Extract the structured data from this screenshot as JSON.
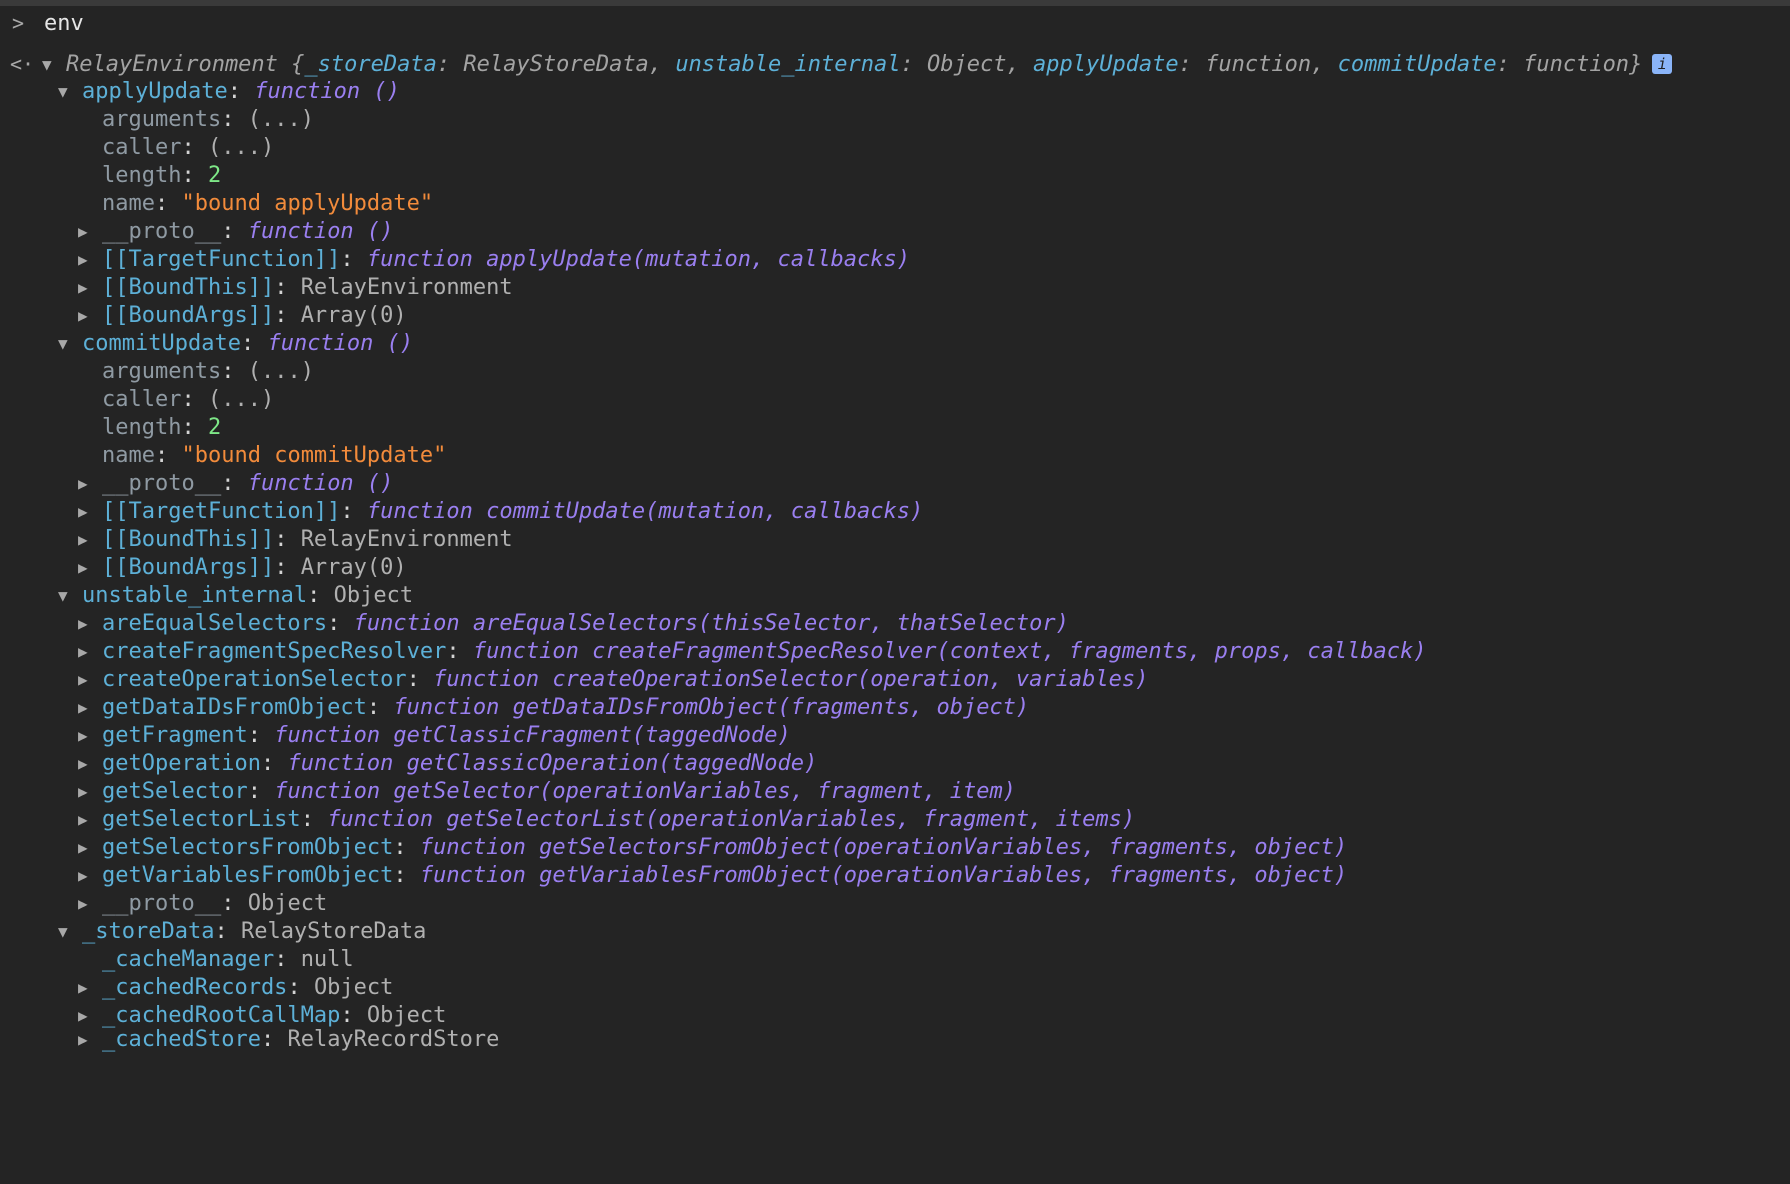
{
  "console": {
    "input": {
      "prompt": ">",
      "command": "env"
    },
    "result": {
      "back_arrow": "<·",
      "class_name": "RelayEnvironment",
      "preview": [
        {
          "key": "_storeData",
          "value": "RelayStoreData"
        },
        {
          "key": "unstable_internal",
          "value": "Object"
        },
        {
          "key": "applyUpdate",
          "value": "function"
        },
        {
          "key": "commitUpdate",
          "value": "function"
        }
      ],
      "info_badge": "i"
    }
  },
  "tree": {
    "applyUpdate": {
      "key": "applyUpdate",
      "value": "function ()",
      "children": {
        "arguments": {
          "key": "arguments",
          "value": "(...)"
        },
        "caller": {
          "key": "caller",
          "value": "(...)"
        },
        "length": {
          "key": "length",
          "value": "2"
        },
        "name": {
          "key": "name",
          "value": "\"bound applyUpdate\""
        },
        "proto": {
          "key": "__proto__",
          "value": "function ()"
        },
        "target": {
          "key": "[[TargetFunction]]",
          "value": "function applyUpdate(mutation, callbacks)"
        },
        "boundThis": {
          "key": "[[BoundThis]]",
          "value": "RelayEnvironment"
        },
        "boundArgs": {
          "key": "[[BoundArgs]]",
          "value": "Array(0)"
        }
      }
    },
    "commitUpdate": {
      "key": "commitUpdate",
      "value": "function ()",
      "children": {
        "arguments": {
          "key": "arguments",
          "value": "(...)"
        },
        "caller": {
          "key": "caller",
          "value": "(...)"
        },
        "length": {
          "key": "length",
          "value": "2"
        },
        "name": {
          "key": "name",
          "value": "\"bound commitUpdate\""
        },
        "proto": {
          "key": "__proto__",
          "value": "function ()"
        },
        "target": {
          "key": "[[TargetFunction]]",
          "value": "function commitUpdate(mutation, callbacks)"
        },
        "boundThis": {
          "key": "[[BoundThis]]",
          "value": "RelayEnvironment"
        },
        "boundArgs": {
          "key": "[[BoundArgs]]",
          "value": "Array(0)"
        }
      }
    },
    "unstable_internal": {
      "key": "unstable_internal",
      "value": "Object",
      "children": {
        "areEqualSelectors": {
          "key": "areEqualSelectors",
          "value": "function areEqualSelectors(thisSelector, thatSelector)"
        },
        "createFragmentSpecResolver": {
          "key": "createFragmentSpecResolver",
          "value": "function createFragmentSpecResolver(context, fragments, props, callback)"
        },
        "createOperationSelector": {
          "key": "createOperationSelector",
          "value": "function createOperationSelector(operation, variables)"
        },
        "getDataIDsFromObject": {
          "key": "getDataIDsFromObject",
          "value": "function getDataIDsFromObject(fragments, object)"
        },
        "getFragment": {
          "key": "getFragment",
          "value": "function getClassicFragment(taggedNode)"
        },
        "getOperation": {
          "key": "getOperation",
          "value": "function getClassicOperation(taggedNode)"
        },
        "getSelector": {
          "key": "getSelector",
          "value": "function getSelector(operationVariables, fragment, item)"
        },
        "getSelectorList": {
          "key": "getSelectorList",
          "value": "function getSelectorList(operationVariables, fragment, items)"
        },
        "getSelectorsFromObject": {
          "key": "getSelectorsFromObject",
          "value": "function getSelectorsFromObject(operationVariables, fragments, object)"
        },
        "getVariablesFromObject": {
          "key": "getVariablesFromObject",
          "value": "function getVariablesFromObject(operationVariables, fragments, object)"
        },
        "proto": {
          "key": "__proto__",
          "value": "Object"
        }
      }
    },
    "_storeData": {
      "key": "_storeData",
      "value": "RelayStoreData",
      "children": {
        "cacheManager": {
          "key": "_cacheManager",
          "value": "null"
        },
        "cachedRecords": {
          "key": "_cachedRecords",
          "value": "Object"
        },
        "cachedRootCallMap": {
          "key": "_cachedRootCallMap",
          "value": "Object"
        },
        "cachedStore": {
          "key": "_cachedStore",
          "value": "RelayRecordStore"
        }
      }
    }
  },
  "colors": {
    "background": "#242424",
    "key": "#5db0d7",
    "function": "#9a7ff0",
    "number": "#7ee787",
    "string": "#f28b3b",
    "info_badge": "#8ab4f8"
  },
  "icons": {
    "expanded": "triangle-down-icon",
    "collapsed": "triangle-right-icon",
    "prompt": "chevron-right-icon",
    "result": "back-arrow-icon"
  }
}
